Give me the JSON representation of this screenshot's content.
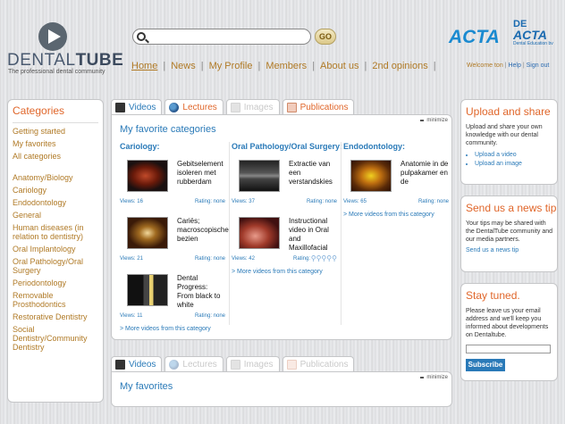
{
  "logo": {
    "name_light": "DENTAL",
    "name_bold": "TUBE",
    "tagline": "The professional dental community"
  },
  "search": {
    "placeholder": "",
    "go_label": "GO"
  },
  "nav": [
    "Home",
    "News",
    "My Profile",
    "Members",
    "About us",
    "2nd opinions"
  ],
  "brand": {
    "acta": "ACTA",
    "de": "DE",
    "de_acta": "ACTA",
    "de_sub": "Dental Education bv"
  },
  "welcome": {
    "text": "Welcome ton",
    "help": "Help",
    "signout": "Sign out"
  },
  "categories": {
    "title": "Categories",
    "top": [
      "Getting started",
      "My favorites",
      "All categories"
    ],
    "items": [
      "Anatomy/Biology",
      "Cariology",
      "Endodontology",
      "General",
      "Human diseases (in relation to dentistry)",
      "Oral Implantology",
      "Oral Pathology/Oral Surgery",
      "Periodontology",
      "Removable Prosthodontics",
      "Restorative Dentistry",
      "Social Dentistry/Community Dentistry"
    ]
  },
  "tabs": [
    "Videos",
    "Lectures",
    "Images",
    "Publications"
  ],
  "main1": {
    "title": "My favorite categories",
    "minimize": "minimize",
    "columns": [
      {
        "heading": "Cariology:",
        "videos": [
          {
            "title": "Gebitselement isoleren met rubberdam",
            "views": "Views: 16",
            "rating": "Rating:  none"
          },
          {
            "title": "Cariës; macroscopische bezien",
            "views": "Views: 21",
            "rating": "Rating:  none"
          },
          {
            "title": "Dental Progress: From black to white",
            "views": "Views: 11",
            "rating": "Rating:  none"
          }
        ],
        "more": "> More videos from this category"
      },
      {
        "heading": "Oral Pathology/Oral Surgery:",
        "videos": [
          {
            "title": "Extractie van een verstandskies",
            "views": "Views: 37",
            "rating": "Rating:  none"
          },
          {
            "title": "Instructional video in Oral and Maxillofacial",
            "views": "Views: 42",
            "rating": "Rating:"
          }
        ],
        "more": "> More videos from this category"
      },
      {
        "heading": "Endodontology:",
        "videos": [
          {
            "title": "Anatomie in de pulpakamer en de",
            "views": "Views: 65",
            "rating": "Rating:  none"
          }
        ],
        "more": "> More videos from this category"
      }
    ]
  },
  "main2": {
    "title": "My favorites",
    "minimize": "minimize"
  },
  "upload": {
    "title": "Upload and share",
    "text": "Upload and share your own knowledge with our dental community.",
    "links": [
      "Upload a video",
      "Upload an image"
    ]
  },
  "newstip": {
    "title": "Send us a news tip",
    "text": "Your tips may be shared with the DentalTube community and our media partners.",
    "link": "Send us a news tip"
  },
  "stay": {
    "title": "Stay tuned.",
    "text": "Please leave us your email address and we'll keep you informed about developments on Dentaltube.",
    "button": "Subscribe"
  }
}
